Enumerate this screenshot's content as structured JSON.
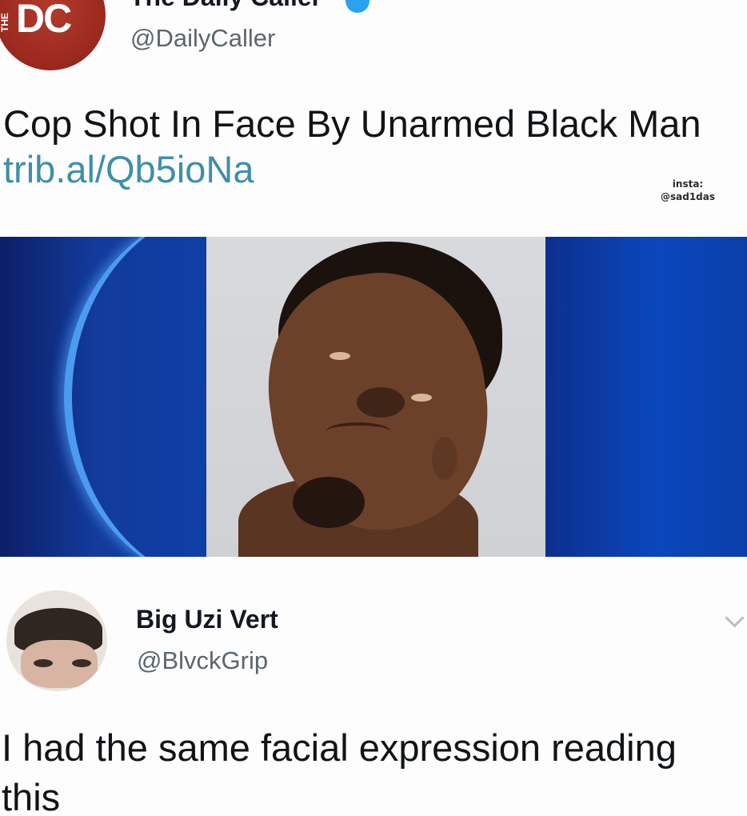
{
  "original_tweet": {
    "avatar": {
      "icon": "daily-caller-logo-icon",
      "letters": "DC",
      "small_letters": "THE",
      "color": "#9e2b20"
    },
    "display_name": "The Daily Caller",
    "verified_icon": "verified-badge-icon",
    "handle": "@DailyCaller",
    "text": "Cop Shot In Face By Unarmed Black Man",
    "link": "trib.al/Qb5ioNa",
    "link_color": "#3f8fa8"
  },
  "watermark": {
    "line1": "insta:",
    "line2": "@sad1das"
  },
  "media": {
    "description_icon": "mugshot-photo",
    "accent_color": "#0a47bd"
  },
  "reply_tweet": {
    "avatar_icon": "user-avatar",
    "display_name": "Big Uzi Vert",
    "handle": "@BlvckGrip",
    "menu_icon": "chevron-down-icon",
    "text": "I had the same facial expression reading this"
  }
}
